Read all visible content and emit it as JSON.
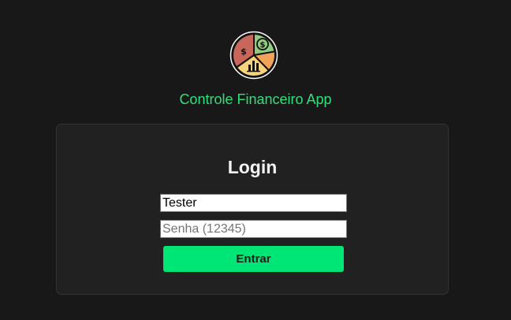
{
  "app": {
    "title": "Controle Financeiro App",
    "logo_icon": "finance-pie-chart-icon",
    "accent_color": "#2ee07a"
  },
  "login": {
    "heading": "Login",
    "username_value": "Tester",
    "password_placeholder": "Senha (12345)",
    "submit_label": "Entrar",
    "button_color": "#00e676"
  }
}
